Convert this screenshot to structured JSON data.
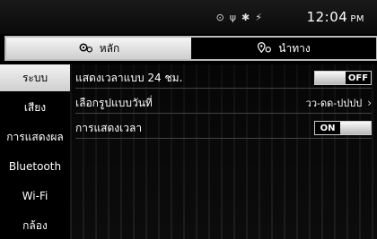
{
  "status": {
    "time": "12:04",
    "ampm": "PM",
    "icons": [
      "navigation-status-icon",
      "usb-icon",
      "bluetooth-icon",
      "signal-icon"
    ]
  },
  "tabs": [
    {
      "label": "หลัก",
      "icon": "gear-icon",
      "active": true
    },
    {
      "label": "นำทาง",
      "icon": "location-gear-icon",
      "active": false
    }
  ],
  "sidebar": {
    "items": [
      {
        "label": "ระบบ",
        "active": true
      },
      {
        "label": "เสียง",
        "active": false
      },
      {
        "label": "การแสดงผล",
        "active": false
      },
      {
        "label": "Bluetooth",
        "active": false
      },
      {
        "label": "Wi-Fi",
        "active": false
      },
      {
        "label": "กล้อง",
        "active": false
      }
    ]
  },
  "settings": {
    "rows": [
      {
        "label": "แสดงเวลาแบบ 24 ชม.",
        "control": "toggle",
        "state": "OFF"
      },
      {
        "label": "เลือกรูปแบบวันที่",
        "control": "value",
        "value": "วว-ดด-ปปปป"
      },
      {
        "label": "การแสดงเวลา",
        "control": "toggle",
        "state": "ON"
      }
    ]
  },
  "colors": {
    "background": "#000000",
    "highlight": "#e6e6e6",
    "text": "#ffffff"
  }
}
